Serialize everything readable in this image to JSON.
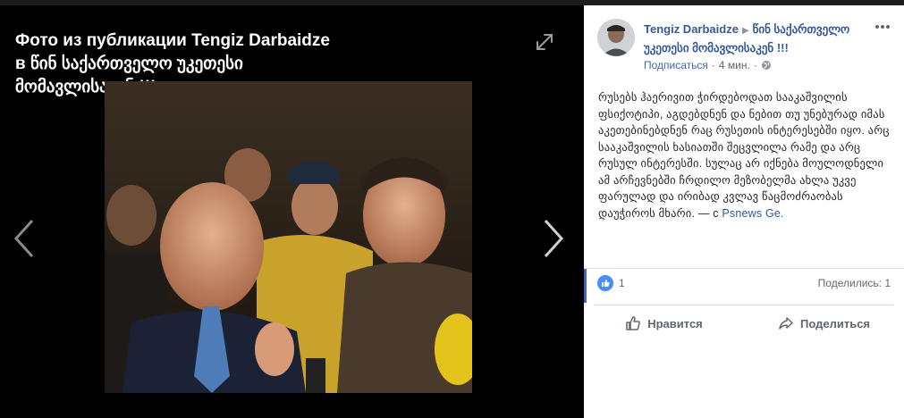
{
  "viewer": {
    "caption_line1": "Фото из публикации Tengiz Darbaidze",
    "caption_line2": "в წინ საქართველო უკეთესი",
    "caption_line3": "მომავლისაკენ !!!",
    "icons": {
      "expand": "expand-icon",
      "prev": "chevron-left-icon",
      "next": "chevron-right-icon"
    }
  },
  "post": {
    "author": "Tengiz Darbaidze",
    "group_line1": "წინ საქართველო",
    "group_line2": "უკეთესი მომავლისაკენ !!!",
    "follow": "Подписаться",
    "dot": "·",
    "time": "4 мин.",
    "dot2": "·",
    "text": "რუსებს ჰაერივით ჭირდებოდათ სააკაშვილის ფსიქოტიპი, აგდებდნენ და ნებით თუ უნებურად იმას აკეთებინებდნენ რაც რუსეთის ინტერესებში იყო. არც სააკაშვილის ხასიათში შეცვლილა რამე და არც რუსულ ინტერესში. სულაც არ იქნება მოულოდნელი ამ არჩევნებში ჩრდილო მეზობელმა ახლა უკვე ფარულად და ირიბად კვლავ წაცმოძრაობას დაუჭიროს მხარი. — с",
    "source": "Psnews Ge.",
    "like_count": "1",
    "shares": "Поделились: 1",
    "like_action": "Нравится",
    "share_action": "Поделиться"
  },
  "colors": {
    "link": "#365899",
    "accent": "#4267b2",
    "like_badge": "#4a8df8"
  }
}
